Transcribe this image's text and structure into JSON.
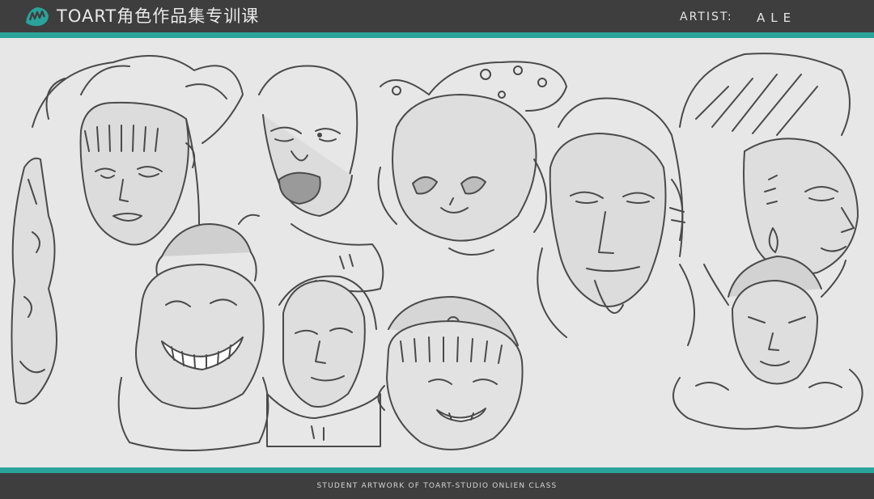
{
  "header": {
    "brand": "TOART角色作品集专训课",
    "artist_label": "ARTIST:",
    "artist_name": "ALE",
    "logo_icon": "toart-logo-icon"
  },
  "footer": {
    "caption": "STUDENT ARTWORK OF TOART-STUDIO ONLIEN CLASS"
  },
  "colors": {
    "bar": "#3e3e3e",
    "accent": "#2aa39a",
    "canvas": "#e7e7e7",
    "ink": "#4a4a4a"
  },
  "artwork": {
    "subject": "character-head-sketches"
  }
}
